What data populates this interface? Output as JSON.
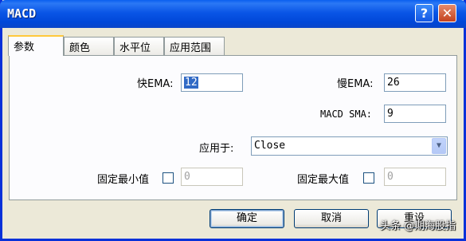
{
  "window": {
    "title": "MACD"
  },
  "tabs": [
    "参数",
    "颜色",
    "水平位",
    "应用范围"
  ],
  "fields": {
    "fast_ema": {
      "label": "快EMA:",
      "value": "12"
    },
    "slow_ema": {
      "label": "慢EMA:",
      "value": "26"
    },
    "macd_sma": {
      "label": "MACD SMA:",
      "value": "9"
    },
    "apply_to": {
      "label": "应用于:",
      "value": "Close"
    },
    "fixed_min": {
      "label": "固定最小值",
      "value": "0"
    },
    "fixed_max": {
      "label": "固定最大值",
      "value": "0"
    }
  },
  "buttons": {
    "ok": "确定",
    "cancel": "取消",
    "reset": "重设"
  },
  "watermark": "头条 @期海股指"
}
